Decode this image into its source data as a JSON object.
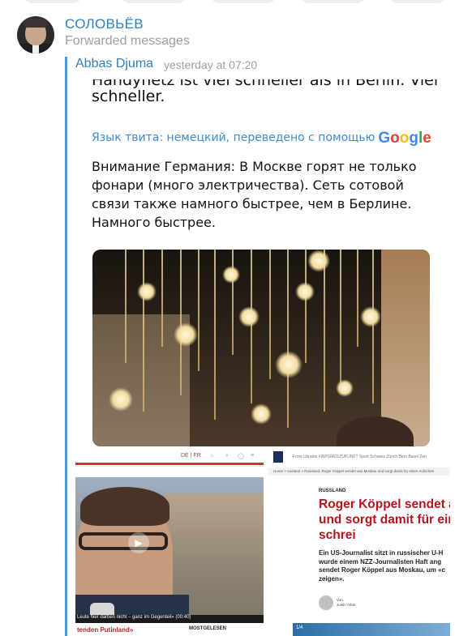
{
  "message": {
    "sender": "СОЛОВЬЁВ",
    "forward_label": "Forwarded messages",
    "original_author": "Abbas Djuma",
    "original_time": "yesterday at 07:20"
  },
  "tweet": {
    "de_cut_line": "Handynetz ist viel schneller als in Berlin. Viel",
    "de_line2": "schneller.",
    "translation_note": "Язык твита: немецкий, переведено с помощью",
    "google_logo": "Google",
    "ru_lines": [
      "Внимание Германия: В Москве горят не только",
      "фонари (много электричества). Сеть сотовой",
      "связи также намного быстрее, чем в Берлине.",
      "Намного быстрее."
    ]
  },
  "screenshot_left": {
    "nav_text": "DE | FR",
    "video_caption": "Leute hier darben nicht – ganz im Gegenteil»",
    "video_time": "(00:40)",
    "sub_headline": "tenden Putinland»",
    "most_read": "MOSTGELESEN"
  },
  "screenshot_right": {
    "menu": "Front   Ukraine   #INPSMEDZUKUNFT   Sport   Schweiz   Zürich   Bern   Basel   Zen",
    "breadcrumb": "Home > Ausland > Russland, Roger Köppel sendet aus Moskau und sorgt damit für einen Aufschrei",
    "section": "RUSSLAND",
    "headline": [
      "Roger Köppel sendet a",
      "und sorgt damit für ein",
      "schrei"
    ],
    "lead": [
      "Ein US-Journalist sitzt in russischer U-H",
      "wurde einem NZZ-Journalisten Haft ang",
      "sendet Roger Köppel aus Moskau, um «c",
      "zeigen»."
    ],
    "author_prefix": "Von",
    "author_name": "Justin Arber",
    "badge": "1/4"
  },
  "colors": {
    "link_blue": "#2e7fc0",
    "forward_bar": "#4a9ad8",
    "meta_gray": "#9aa0a6",
    "headline_red": "#b5141f"
  }
}
